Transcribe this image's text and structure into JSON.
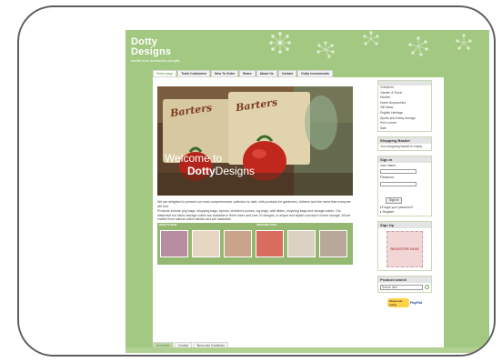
{
  "site": {
    "logo_line1": "Dotty",
    "logo_line2": "Designs",
    "tagline": "handle home accessories and gifts",
    "accent_color": "#a3c882"
  },
  "nav": {
    "items": [
      {
        "label": "Home page",
        "active": true
      },
      {
        "label": "Trade Customers",
        "active": false
      },
      {
        "label": "How To Order",
        "active": false
      },
      {
        "label": "Bears",
        "active": false
      },
      {
        "label": "About Us",
        "active": false
      },
      {
        "label": "Contact",
        "active": false
      },
      {
        "label": "Dotty recommends",
        "active": false
      }
    ]
  },
  "hero": {
    "brand_left": "Barters",
    "brand_right": "Barters",
    "welcome_line1": "Welcome to",
    "welcome_bold": "Dotty",
    "welcome_rest": "Designs"
  },
  "intro": {
    "p1": "We are delighted to present our most comprehensive collection to date, with products for gardeners, children and the home that everyone will love.",
    "p2": "Products include peg bags, shopping bags, aprons, children's purses, log bags, wall bibles, recycling bags and storage cubes. Our distinctive fun fabric storage cubes are available in three sizes and over 20 designs, a unique and stylish concept in home storage. All are crafted from natural cotton fabrics and are washable."
  },
  "strip": {
    "left_heading": "WHAT'S NEW",
    "right_heading": "BESTSELLERS",
    "thumb_colors": [
      "#b88ca0",
      "#e6d6c2",
      "#c8a58a",
      "#d76c5f",
      "#dcd2c4",
      "#b8a89a"
    ]
  },
  "sidebar": {
    "categories": [
      "Children's",
      "Garden & Floral",
      "Kitchen",
      "Home Accessories",
      "Gift ideas",
      "English Heritage",
      "Sports and hobby storage",
      "Pet's corner",
      "Sale"
    ],
    "basket_title": "Shopping Basket",
    "basket_text": "Your shopping basket is empty",
    "signin_title": "Sign in",
    "user_label": "User Name",
    "password_label": "Password",
    "signin_button": "Sign in",
    "forgot_link": "▸Forgot your password?",
    "register_link": "▸ Register",
    "signup_title": "Sign Up",
    "register_badge": "REGISTER NOW",
    "search_title": "Product search",
    "search_placeholder": "Search item",
    "paypal_pill": "Shop now using",
    "paypal_logo": "PayPal"
  },
  "footer": {
    "items": [
      {
        "label": "Newsletter",
        "active": true
      },
      {
        "label": "Contact",
        "active": false
      },
      {
        "label": "Terms and Conditions",
        "active": false
      }
    ]
  }
}
